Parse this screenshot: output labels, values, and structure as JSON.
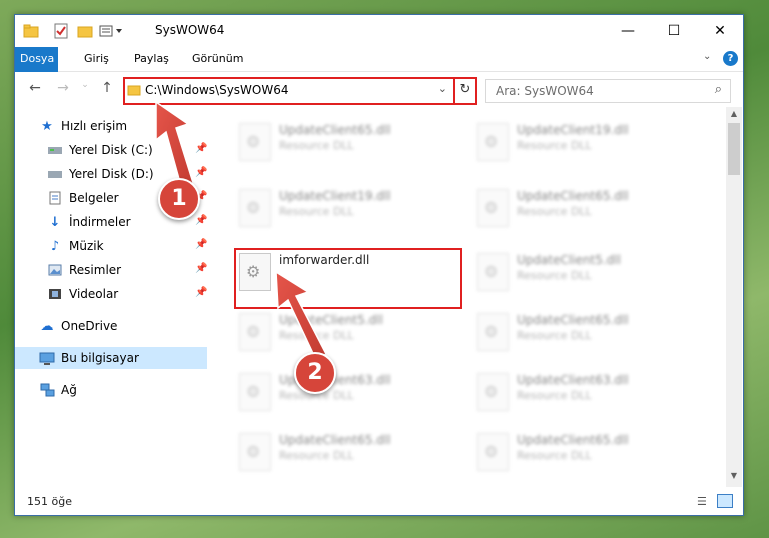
{
  "window": {
    "title": "SysWOW64"
  },
  "ribbon": {
    "tabs": [
      "Dosya",
      "Giriş",
      "Paylaş",
      "Görünüm"
    ]
  },
  "address": {
    "path": "C:\\Windows\\SysWOW64"
  },
  "search": {
    "placeholder": "Ara: SysWOW64"
  },
  "nav": {
    "items": [
      {
        "label": "Hızlı erişim",
        "icon": "star-icon",
        "pinned": false
      },
      {
        "label": "Yerel Disk (C:)",
        "icon": "drive-icon",
        "pinned": true
      },
      {
        "label": "Yerel Disk (D:)",
        "icon": "drive-icon",
        "pinned": true
      },
      {
        "label": "Belgeler",
        "icon": "documents-icon",
        "pinned": true
      },
      {
        "label": "İndirmeler",
        "icon": "download-icon",
        "pinned": true
      },
      {
        "label": "Müzik",
        "icon": "music-icon",
        "pinned": true
      },
      {
        "label": "Resimler",
        "icon": "pictures-icon",
        "pinned": true
      },
      {
        "label": "Videolar",
        "icon": "videos-icon",
        "pinned": true
      },
      {
        "label": "OneDrive",
        "icon": "cloud-icon",
        "pinned": false
      },
      {
        "label": "Bu bilgisayar",
        "icon": "computer-icon",
        "pinned": false,
        "selected": true
      },
      {
        "label": "Ağ",
        "icon": "network-icon",
        "pinned": false
      }
    ]
  },
  "files": [
    {
      "name": "UpdateClient65.dll",
      "type": "Resource DLL",
      "blurred": true
    },
    {
      "name": "UpdateClient19.dll",
      "type": "Resource DLL",
      "blurred": true
    },
    {
      "name": "UpdateClient19.dll",
      "type": "Resource DLL",
      "blurred": true
    },
    {
      "name": "UpdateClient65.dll",
      "type": "Resource DLL",
      "blurred": true
    },
    {
      "name": "imforwarder.dll",
      "type": "",
      "blurred": false
    },
    {
      "name": "UpdateClient5.dll",
      "type": "Resource DLL",
      "blurred": true
    },
    {
      "name": "UpdateClient5.dll",
      "type": "Resource DLL",
      "blurred": true
    },
    {
      "name": "UpdateClient65.dll",
      "type": "Resource DLL",
      "blurred": true
    },
    {
      "name": "UpdateClient63.dll",
      "type": "Resource DLL",
      "blurred": true
    },
    {
      "name": "UpdateClient63.dll",
      "type": "Resource DLL",
      "blurred": true
    },
    {
      "name": "UpdateClient65.dll",
      "type": "Resource DLL",
      "blurred": true
    },
    {
      "name": "UpdateClient65.dll",
      "type": "Resource DLL",
      "blurred": true
    }
  ],
  "status": {
    "count": "151 öğe"
  },
  "annotations": {
    "step1": "1",
    "step2": "2"
  },
  "colors": {
    "accent": "#1979ca",
    "highlight": "#e02020",
    "badge": "#d6453a"
  }
}
